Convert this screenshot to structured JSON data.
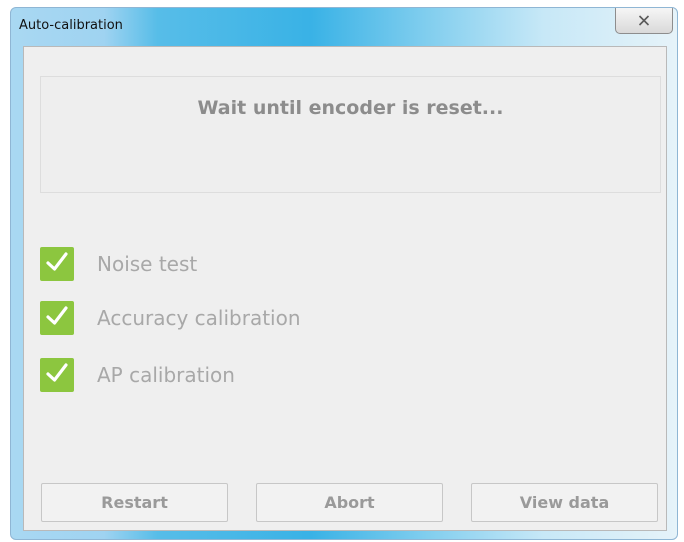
{
  "window": {
    "title": "Auto-calibration",
    "close_icon": "close-icon"
  },
  "status": {
    "message": "Wait until encoder is reset..."
  },
  "steps": [
    {
      "label": "Noise test",
      "checked": true,
      "icon": "checkmark-icon"
    },
    {
      "label": "Accuracy calibration",
      "checked": true,
      "icon": "checkmark-icon"
    },
    {
      "label": "AP calibration",
      "checked": true,
      "icon": "checkmark-icon"
    }
  ],
  "buttons": {
    "restart": "Restart",
    "abort": "Abort",
    "view_data": "View data"
  },
  "colors": {
    "check_green": "#8cc63f",
    "disabled_text": "#a8a8a8",
    "title_bar_blue": "#39b2e6"
  }
}
